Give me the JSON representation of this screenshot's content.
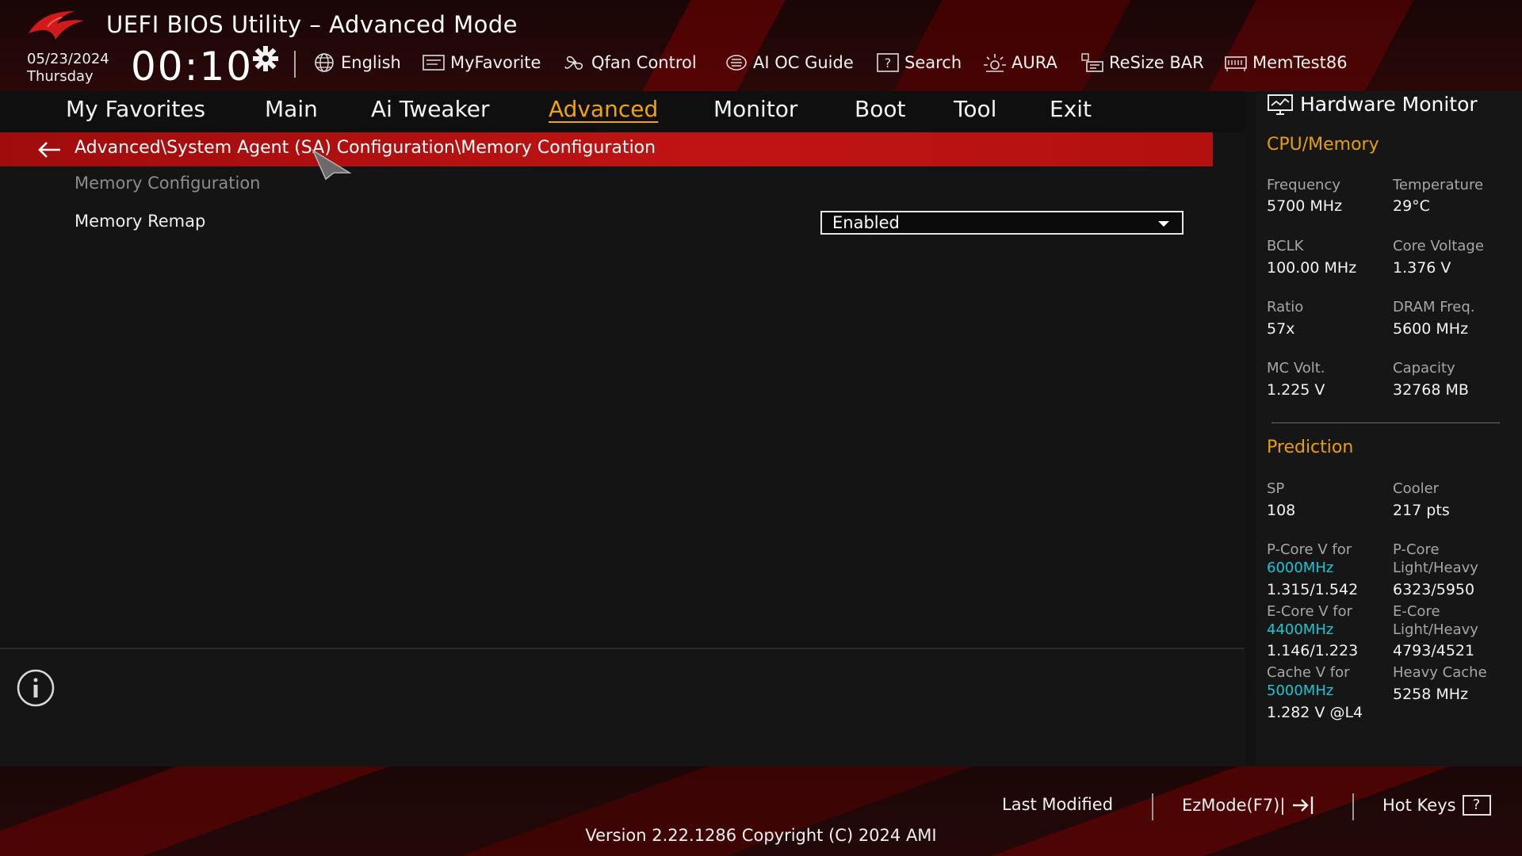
{
  "header": {
    "title": "UEFI BIOS Utility – Advanced Mode",
    "date": "05/23/2024",
    "day": "Thursday",
    "time": "00:10",
    "toolbar": [
      {
        "label": "English",
        "icon": "globe-icon"
      },
      {
        "label": "MyFavorite",
        "icon": "favorite-icon"
      },
      {
        "label": "Qfan Control",
        "icon": "fan-icon"
      },
      {
        "label": "AI OC Guide",
        "icon": "ai-guide-icon"
      },
      {
        "label": "Search",
        "icon": "search-icon"
      },
      {
        "label": "AURA",
        "icon": "aura-icon"
      },
      {
        "label": "ReSize BAR",
        "icon": "resize-bar-icon"
      },
      {
        "label": "MemTest86",
        "icon": "memtest-icon"
      }
    ]
  },
  "menu": {
    "items": [
      "My Favorites",
      "Main",
      "Ai Tweaker",
      "Advanced",
      "Monitor",
      "Boot",
      "Tool",
      "Exit"
    ],
    "active": "Advanced"
  },
  "main": {
    "breadcrumb": "Advanced\\System Agent (SA) Configuration\\Memory Configuration",
    "section_title": "Memory Configuration",
    "settings": [
      {
        "label": "Memory Remap",
        "value": "Enabled"
      }
    ]
  },
  "hardware_monitor": {
    "title": "Hardware Monitor",
    "cpu_memory": {
      "heading": "CPU/Memory",
      "items": [
        {
          "label": "Frequency",
          "value": "5700 MHz"
        },
        {
          "label": "Temperature",
          "value": "29°C"
        },
        {
          "label": "BCLK",
          "value": "100.00 MHz"
        },
        {
          "label": "Core Voltage",
          "value": "1.376 V"
        },
        {
          "label": "Ratio",
          "value": "57x"
        },
        {
          "label": "DRAM Freq.",
          "value": "5600 MHz"
        },
        {
          "label": "MC Volt.",
          "value": "1.225 V"
        },
        {
          "label": "Capacity",
          "value": "32768 MB"
        }
      ]
    },
    "prediction": {
      "heading": "Prediction",
      "sp_label": "SP",
      "sp_value": "108",
      "cooler_label": "Cooler",
      "cooler_value": "217 pts",
      "pcore_v_label": "P-Core V for",
      "pcore_v_freq": "6000MHz",
      "pcore_v_value": "1.315/1.542",
      "pcore_lh_label1": "P-Core",
      "pcore_lh_label2": "Light/Heavy",
      "pcore_lh_value": "6323/5950",
      "ecore_v_label": "E-Core V for",
      "ecore_v_freq": "4400MHz",
      "ecore_v_value": "1.146/1.223",
      "ecore_lh_label1": "E-Core",
      "ecore_lh_label2": "Light/Heavy",
      "ecore_lh_value": "4793/4521",
      "cache_v_label": "Cache V for",
      "cache_v_freq": "5000MHz",
      "cache_v_value": "1.282 V @L4",
      "heavy_cache_label": "Heavy Cache",
      "heavy_cache_value": "5258 MHz"
    }
  },
  "footer": {
    "last_modified": "Last Modified",
    "ezmode": "EzMode(F7)|",
    "hotkeys": "Hot Keys",
    "hotkeys_glyph": "?",
    "version": "Version 2.22.1286 Copyright (C) 2024 AMI"
  },
  "colors": {
    "accent": "#f2a400",
    "breadcrumb_bg": "#c01414",
    "frequency_highlight": "#17c7d6",
    "section_heading": "#e8a000"
  }
}
